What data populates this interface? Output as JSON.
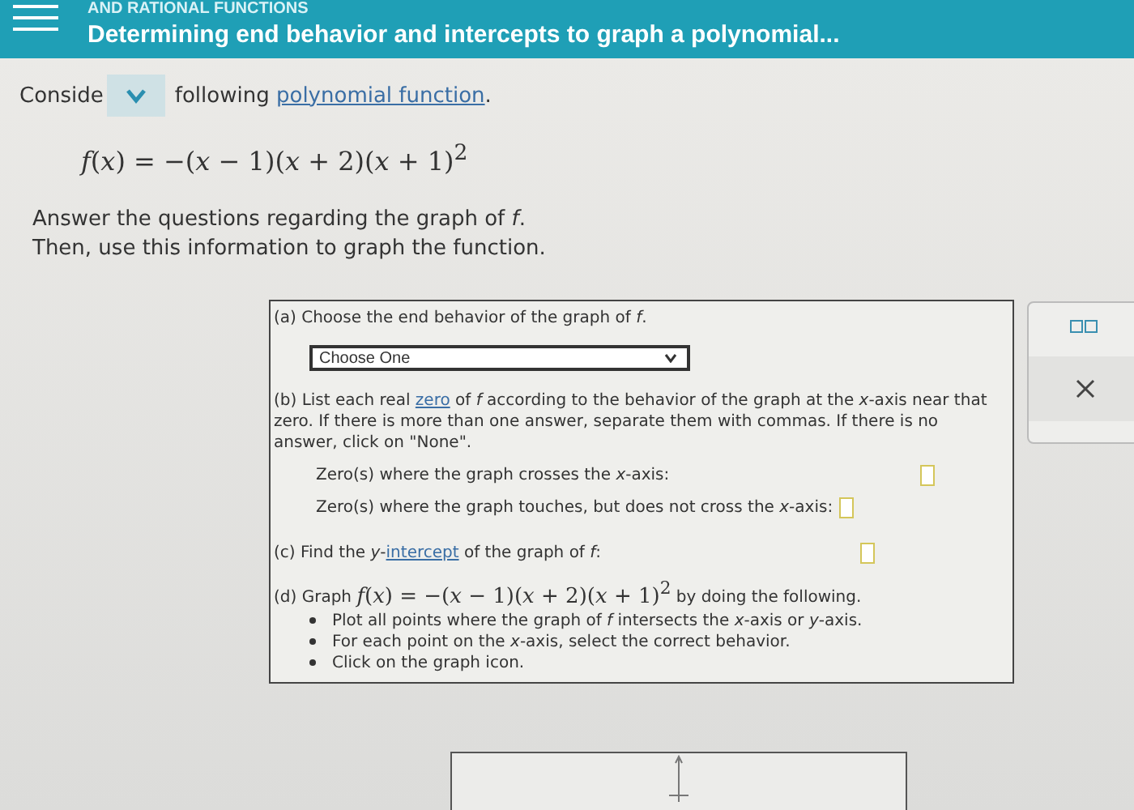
{
  "header": {
    "topic": "AND RATIONAL FUNCTIONS",
    "title": "Determining end behavior and intercepts to graph a polynomial..."
  },
  "intro": {
    "start": "Conside",
    "rest": "following ",
    "link": "polynomial function",
    "end": "."
  },
  "formula": "*f*(*x*) = −(*x* − 1)(*x* + 2)(*x* + 1)$^{2}$",
  "instructions": [
    "Answer the questions regarding the graph of *f*.",
    "Then, use this information to graph the function."
  ],
  "part_a": {
    "label": "(a)",
    "text": "Choose the end behavior of the graph of *f*.",
    "select": "Choose One"
  },
  "part_b": {
    "label": "(b)",
    "before": "List each real ",
    "link": "zero",
    "after": " of *f* according to the behavior of the graph at the *x*-axis near that zero. If there is more than one answer, separate them with commas. If there is no answer, click on \"None\".",
    "fields": [
      {
        "label": "Zero(s) where the graph crosses the *x*-axis:"
      },
      {
        "label": "Zero(s) where the graph touches, but does not cross the *x*-axis:"
      }
    ]
  },
  "part_c": {
    "label": "(c)",
    "before": "Find the *y*-",
    "link": "intercept",
    "after": " of the graph of *f*:"
  },
  "part_d": {
    "label": "(d)",
    "before": "Graph ",
    "formula": "*f*(*x*) = −(*x* − 1)(*x* + 2)(*x* + 1)$^{2}$",
    "after": " by doing the following.",
    "bullets": [
      "Plot all points where the graph of *f* intersects the *x*-axis or *y*-axis.",
      "For each point on the *x*-axis, select the correct behavior.",
      "Click on the graph icon."
    ]
  }
}
